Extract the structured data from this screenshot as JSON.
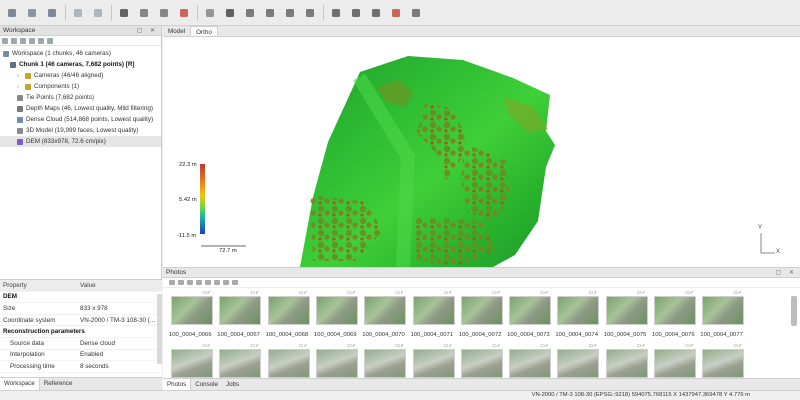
{
  "toolbar_icons": [
    "new-project-icon",
    "open-icon",
    "save-icon",
    "undo-icon",
    "redo-icon",
    "select-icon",
    "rectangle-select-icon",
    "ruler-icon",
    "brush-icon",
    "reset-view-icon",
    "shading-icon",
    "rotate-icon",
    "zoom-in-icon",
    "zoom-out-icon",
    "move-icon",
    "navigation-icon",
    "grid-icon",
    "capture-icon",
    "orthophoto-icon",
    "palette-icon"
  ],
  "workspace": {
    "title": "Workspace",
    "tree": [
      {
        "label": "Workspace (1 chunks, 46 cameras)",
        "level": 0,
        "icon": "workspace-icon"
      },
      {
        "label": "Chunk 1 (46 cameras, 7,682 points) [R]",
        "level": 1,
        "icon": "chunk-icon",
        "bold": true
      },
      {
        "label": "Cameras (46/46 aligned)",
        "level": 2,
        "icon": "cameras-icon",
        "expand": true
      },
      {
        "label": "Components (1)",
        "level": 2,
        "icon": "components-icon",
        "expand": true
      },
      {
        "label": "Tie Points (7,682 points)",
        "level": 2,
        "icon": "tie-points-icon"
      },
      {
        "label": "Depth Maps (46, Lowest quality, Mild filtering)",
        "level": 2,
        "icon": "depth-maps-icon"
      },
      {
        "label": "Dense Cloud (514,868 points, Lowest quality)",
        "level": 2,
        "icon": "dense-cloud-icon"
      },
      {
        "label": "3D Model (19,999 faces, Lowest quality)",
        "level": 2,
        "icon": "model-icon"
      },
      {
        "label": "DEM (833x978, 72.6 cm/pix)",
        "level": 2,
        "icon": "dem-icon",
        "selected": true
      }
    ]
  },
  "properties": {
    "header_property": "Property",
    "header_value": "Value",
    "rows": [
      {
        "type": "sec",
        "key": "DEM",
        "value": ""
      },
      {
        "type": "row",
        "key": "Size",
        "value": "833 x 978"
      },
      {
        "type": "row",
        "key": "Coordinate system",
        "value": "VN-2000 / TM-3 108-30 (..."
      },
      {
        "type": "sec",
        "key": "Reconstruction parameters",
        "value": ""
      },
      {
        "type": "sub",
        "key": "Source data",
        "value": "Dense cloud"
      },
      {
        "type": "sub",
        "key": "Interpolation",
        "value": "Enabled"
      },
      {
        "type": "sub",
        "key": "Processing time",
        "value": "8 seconds"
      }
    ]
  },
  "left_tabs": [
    "Workspace",
    "Reference"
  ],
  "view_tabs": [
    "Model",
    "Ortho"
  ],
  "active_view_tab": "Ortho",
  "legend": {
    "max": "22.3 m",
    "mid": "5.42 m",
    "min": "-11.5 m",
    "scale": "72.7 m"
  },
  "axis": {
    "y": "Y",
    "x": "X"
  },
  "photos": {
    "title": "Photos",
    "row1": [
      "100_0004_0066",
      "100_0004_0067",
      "100_0004_0068",
      "100_0004_0069",
      "100_0004_0070",
      "100_0004_0071",
      "100_0004_0072",
      "100_0004_0073",
      "100_0004_0074",
      "100_0004_0075",
      "100_0004_0076",
      "100_0004_0077"
    ],
    "thumb_mark": "▭✓"
  },
  "bottom_tabs": [
    "Photos",
    "Console",
    "Jobs"
  ],
  "status": "VN-2000 / TM-3 108-30 (EPSG::9218)  594075.768115 X  1437947.369478 Y  4.776 m",
  "colors": {
    "dem_high": "#c0392b",
    "dem_mid": "#f1c40f",
    "dem_green": "#2ecc40",
    "dem_low": "#1f3fbf",
    "selection": "#e5e5e5",
    "accent": "#3d7fd6"
  }
}
